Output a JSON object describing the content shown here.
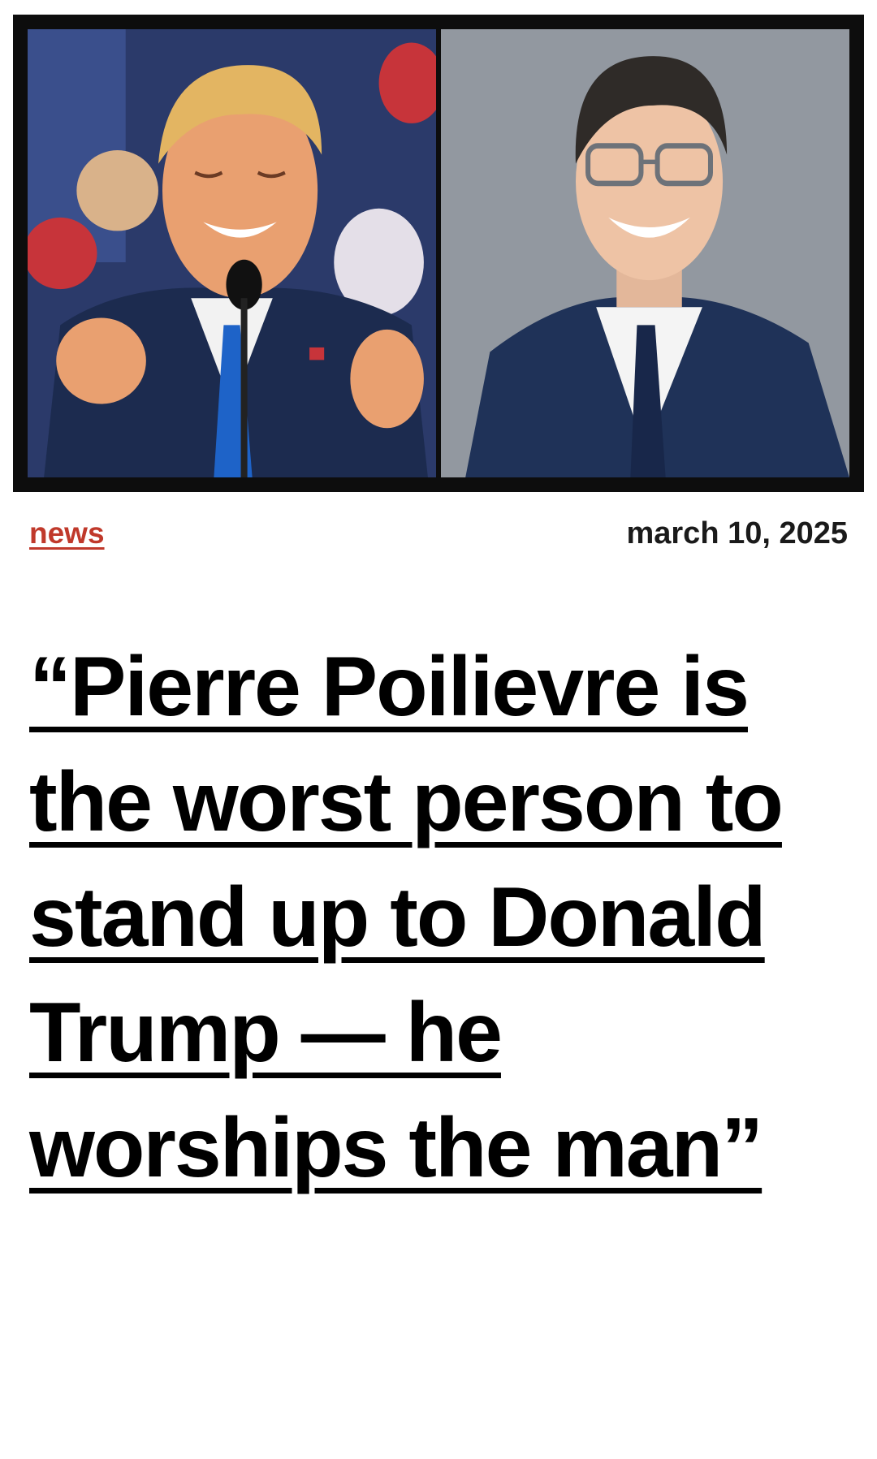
{
  "hero": {
    "left_photo": "Donald Trump speaking at a rally microphone",
    "right_photo": "Pierre Poilievre smiling in a navy suit",
    "colors": {
      "frame": "#0d0d0d",
      "suit_navy": "#1c2b4f",
      "tie_blue": "#1e63c8",
      "backdrop_grey": "#8a9098"
    }
  },
  "article": {
    "category": "news",
    "date": "march 10, 2025",
    "headline": "“Pierre Poilievre is the worst person to stand up to Donald Trump — he worships the man”"
  },
  "colors": {
    "category_red": "#c0392b",
    "text": "#000000"
  }
}
